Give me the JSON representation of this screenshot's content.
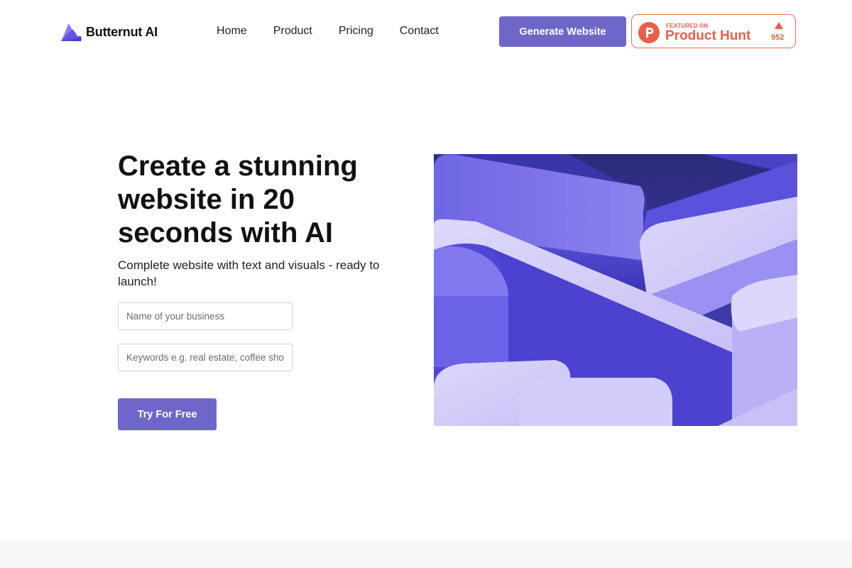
{
  "brand": {
    "name": "Butternut AI",
    "logo_icon": "layered-wing-logo-icon",
    "accent": "#6e67c9"
  },
  "nav": {
    "items": [
      {
        "label": "Home"
      },
      {
        "label": "Product"
      },
      {
        "label": "Pricing"
      },
      {
        "label": "Contact"
      }
    ]
  },
  "header": {
    "cta_label": "Generate Website",
    "product_hunt": {
      "featured_label": "FEATURED ON",
      "name": "Product Hunt",
      "upvotes": "952",
      "color": "#e8604a"
    }
  },
  "hero": {
    "title": "Create a stunning website in 20 seconds with AI",
    "subtitle": "Complete website with text and visuals - ready to launch!",
    "business_placeholder": "Name of your business",
    "keywords_placeholder": "Keywords e.g. real estate, coffee shop",
    "cta_label": "Try For Free",
    "image": "abstract-3d-purple-shapes-image"
  }
}
